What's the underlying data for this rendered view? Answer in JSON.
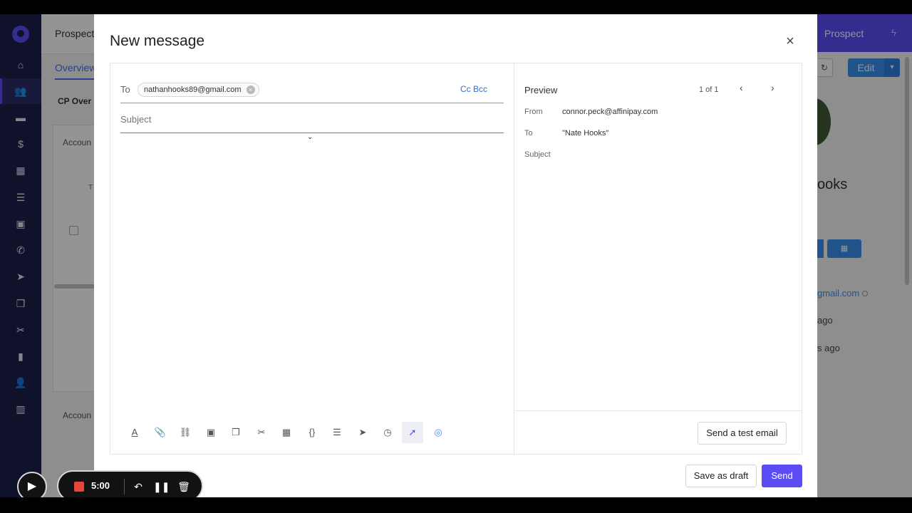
{
  "background": {
    "header_title": "Prospect",
    "tab": "Overview",
    "section": "CP Over",
    "account_label_1": "Accoun",
    "account_label_2": "Accoun",
    "col_fragment": "T",
    "prospect_badge": "Prospect",
    "edit_button": "Edit",
    "name_fragment": "ooks",
    "email_fragment": "gmail.com",
    "ago_1": "ago",
    "ago_2": "s ago"
  },
  "modal": {
    "title": "New message",
    "to_label": "To",
    "recipient": "nathanhooks89@gmail.com",
    "cc_bcc": "Cc Bcc",
    "subject_placeholder": "Subject",
    "preview": {
      "title": "Preview",
      "count": "1 of 1",
      "from_label": "From",
      "from_value": "connor.peck@affinipay.com",
      "to_label": "To",
      "to_value": "\"Nate Hooks\"",
      "subject_label": "Subject"
    },
    "test_email_button": "Send a test email",
    "save_draft_button": "Save as draft",
    "send_button": "Send"
  },
  "recorder": {
    "time": "5:00"
  },
  "colors": {
    "accent": "#5b4cf5",
    "sidebar": "#1d1f4b",
    "link": "#2f6fde"
  }
}
